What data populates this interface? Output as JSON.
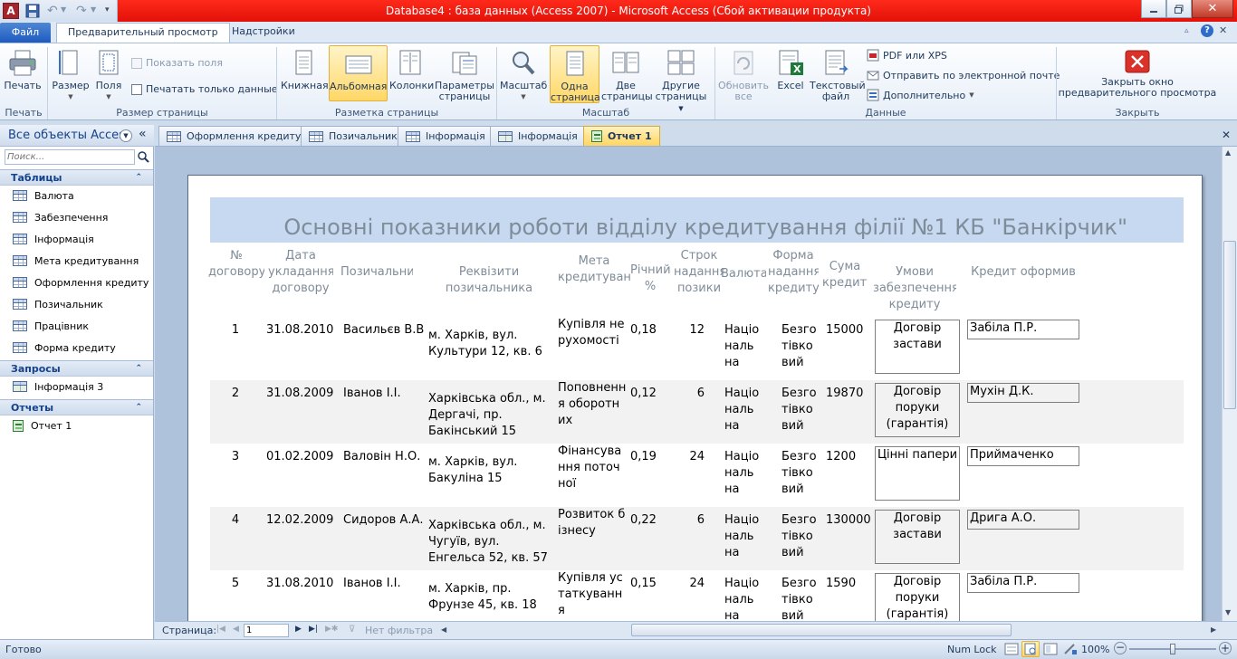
{
  "window": {
    "title": "Database4 : база данных (Access 2007)  -  Microsoft Access (Сбой активации продукта)"
  },
  "ribbon_tabs": {
    "file": "Файл",
    "preview": "Предварительный просмотр",
    "addins": "Надстройки"
  },
  "ribbon": {
    "print": {
      "button": "Печать",
      "group": "Печать"
    },
    "page_size": {
      "size": "Размер",
      "margins": "Поля",
      "show_margins": "Показать поля",
      "print_data_only": "Печатать только данные",
      "group": "Размер страницы"
    },
    "layout": {
      "portrait": "Книжная",
      "landscape": "Альбомная",
      "columns": "Колонки",
      "page_setup_1": "Параметры",
      "page_setup_2": "страницы",
      "group": "Разметка страницы"
    },
    "zoom": {
      "zoom": "Масштаб",
      "one_page_1": "Одна",
      "one_page_2": "страница",
      "two_pages_1": "Две",
      "two_pages_2": "страницы",
      "more_pages_1": "Другие",
      "more_pages_2": "страницы",
      "group": "Масштаб"
    },
    "data": {
      "refresh_1": "Обновить",
      "refresh_2": "все",
      "excel": "Excel",
      "text_1": "Текстовый",
      "text_2": "файл",
      "pdf": "PDF или XPS",
      "email": "Отправить по электронной почте",
      "more": "Дополнительно",
      "group": "Данные"
    },
    "close": {
      "label_1": "Закрыть окно",
      "label_2": "предварительного просмотра",
      "group": "Закрыть"
    }
  },
  "nav": {
    "header": "Все объекты Access",
    "search_placeholder": "Поиск...",
    "sections": [
      {
        "title": "Таблицы",
        "items": [
          "Валюта",
          "Забезпечення",
          "Інформація",
          "Мета кредитування",
          "Оформлення кредиту",
          "Позичальник",
          "Працівник",
          "Форма кредиту"
        ]
      },
      {
        "title": "Запросы",
        "items": [
          "Інформація 3"
        ]
      },
      {
        "title": "Отчеты",
        "items": [
          "Отчет 1"
        ]
      }
    ]
  },
  "doc_tabs": [
    "Оформлення кредиту",
    "Позичальник",
    "Інформація",
    "Інформація",
    "Отчет 1"
  ],
  "report": {
    "title": "Основні показники роботи відділу кредитування філії №1 КБ \"Банкірчик\"",
    "columns": [
      "№ договору",
      "Дата укладання договору",
      "Позичальни",
      "Реквізити позичальника",
      "Мета кредитування",
      "Річний %",
      "Строк надання позики",
      "Валюта",
      "Форма надання кредиту",
      "Сума кредиту",
      "Умови забезпечення кредиту",
      "Кредит оформив"
    ],
    "rows": [
      {
        "no": "1",
        "date": "31.08.2010",
        "borrower": "Васильєв В.В",
        "details": "м. Харків, вул. Культури 12, кв. 6",
        "purpose": "Купівля нерухомості",
        "rate": "0,18",
        "term": "12",
        "currency": "Національна",
        "form": "Безготівковий",
        "sum": "15000",
        "security": "Договір застави",
        "officer": "Забіла П.Р."
      },
      {
        "no": "2",
        "date": "31.08.2009",
        "borrower": "Іванов І.І.",
        "details": "Харківська обл., м. Дергачі, пр. Бакінський 15",
        "purpose": "Поповнення оборотних",
        "rate": "0,12",
        "term": "6",
        "currency": "Національна",
        "form": "Безготівковий",
        "sum": "19870",
        "security": "Договір поруки (гарантія)",
        "officer": "Мухін Д.К."
      },
      {
        "no": "3",
        "date": "01.02.2009",
        "borrower": "Валовін Н.О.",
        "details": "м. Харків, вул. Бакуліна 15",
        "purpose": "Фінансування поточної",
        "rate": "0,19",
        "term": "24",
        "currency": "Національна",
        "form": "Безготівковий",
        "sum": "1200",
        "security": "Цінні папери",
        "officer": "Приймаченко К.Г."
      },
      {
        "no": "4",
        "date": "12.02.2009",
        "borrower": "Сидоров А.А.",
        "details": "Харківська обл., м. Чугуїв, вул. Енгельса 52, кв. 57",
        "purpose": "Розвиток бізнесу",
        "rate": "0,22",
        "term": "6",
        "currency": "Національна",
        "form": "Безготівковий",
        "sum": "130000",
        "security": "Договір застави",
        "officer": "Дрига А.О."
      },
      {
        "no": "5",
        "date": "31.08.2010",
        "borrower": "Іванов І.І.",
        "details": "м. Харків, пр. Фрунзе 45, кв. 18",
        "purpose": "Купівля устаткування",
        "rate": "0,15",
        "term": "24",
        "currency": "Національна",
        "form": "Безготівковий",
        "sum": "1590",
        "security": "Договір поруки (гарантія)",
        "officer": "Забіла П.Р."
      }
    ]
  },
  "pager": {
    "label": "Страница:",
    "page": "1",
    "filter": "Нет фильтра"
  },
  "status": {
    "ready": "Готово",
    "numlock": "Num Lock",
    "zoom": "100%"
  }
}
